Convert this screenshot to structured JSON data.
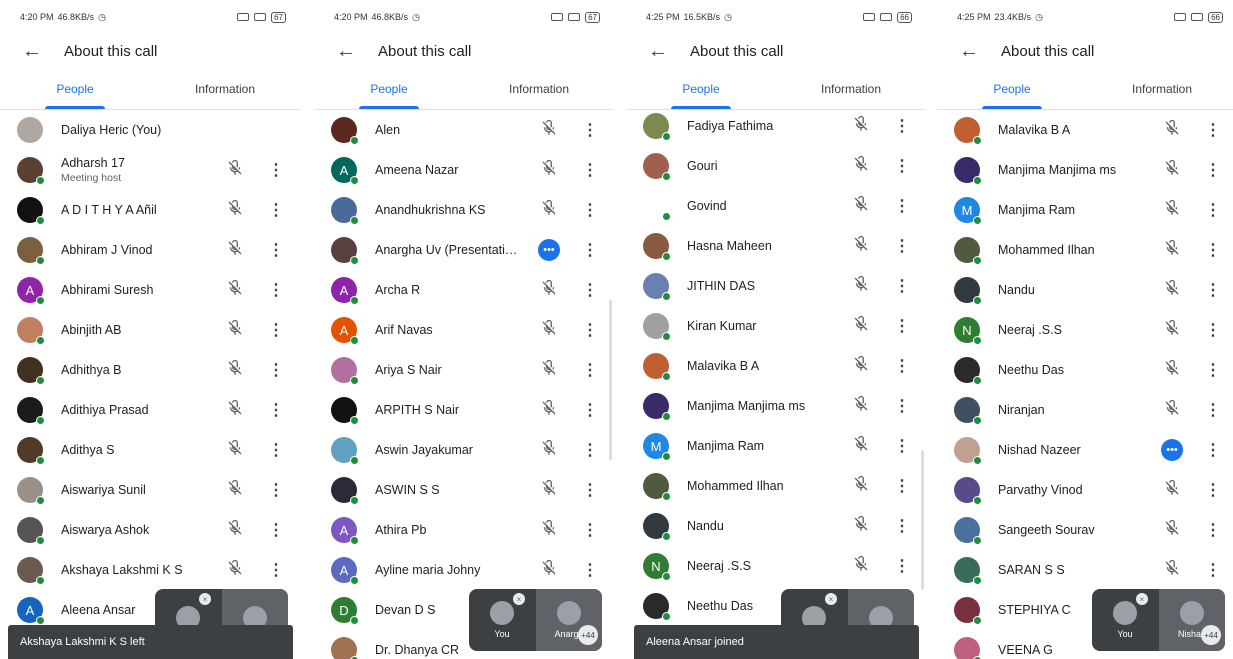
{
  "colors": {
    "accent": "#1a73e8",
    "online": "#1e8e3e",
    "toast": "#3c4043"
  },
  "icons": {
    "back": "arrow-left-icon",
    "mute": "mic-off-icon",
    "more": "more-vert-icon",
    "presenting": "presenting-icon"
  },
  "panels": [
    {
      "status": {
        "time": "4:20 PM",
        "speed": "46.8KB/s",
        "battery": "67"
      },
      "header": {
        "title": "About this call"
      },
      "tabs": {
        "people": "People",
        "information": "Information"
      },
      "people": [
        {
          "name": "Daliya Heric (You)",
          "sub": "",
          "mute": false,
          "more": false,
          "color": "#b0a8a0",
          "letter": ""
        },
        {
          "name": "Adharsh 17",
          "sub": "Meeting host",
          "mute": true,
          "more": true,
          "color": "#5a4030",
          "letter": ""
        },
        {
          "name": "A D I T H Y A Añil",
          "sub": "",
          "mute": true,
          "more": true,
          "color": "#111111",
          "letter": ""
        },
        {
          "name": "Abhiram J Vinod",
          "sub": "",
          "mute": true,
          "more": true,
          "color": "#7a6040",
          "letter": ""
        },
        {
          "name": "Abhirami Suresh",
          "sub": "",
          "mute": true,
          "more": true,
          "color": "#8e24aa",
          "letter": "A"
        },
        {
          "name": "Abinjith AB",
          "sub": "",
          "mute": true,
          "more": true,
          "color": "#c08060",
          "letter": ""
        },
        {
          "name": "Adhithya B",
          "sub": "",
          "mute": true,
          "more": true,
          "color": "#403020",
          "letter": ""
        },
        {
          "name": "Adithiya Prasad",
          "sub": "",
          "mute": true,
          "more": true,
          "color": "#1a1a1a",
          "letter": ""
        },
        {
          "name": "Adithya S",
          "sub": "",
          "mute": true,
          "more": true,
          "color": "#503a28",
          "letter": ""
        },
        {
          "name": "Aiswariya Sunil",
          "sub": "",
          "mute": true,
          "more": true,
          "color": "#9a9088",
          "letter": ""
        },
        {
          "name": "Aiswarya Ashok",
          "sub": "",
          "mute": true,
          "more": true,
          "color": "#555555",
          "letter": ""
        },
        {
          "name": "Akshaya Lakshmi K S",
          "sub": "",
          "mute": true,
          "more": true,
          "color": "#6a5a50",
          "letter": ""
        },
        {
          "name": "Aleena Ansar",
          "sub": "",
          "mute": false,
          "more": false,
          "color": "#1565c0",
          "letter": "A"
        }
      ],
      "toast": "Akshaya Lakshmi K S left",
      "pip": {
        "you_label": "",
        "other_label": "",
        "badge": ""
      }
    },
    {
      "status": {
        "time": "4:20 PM",
        "speed": "46.8KB/s",
        "battery": "67"
      },
      "header": {
        "title": "About this call"
      },
      "tabs": {
        "people": "People",
        "information": "Information"
      },
      "people": [
        {
          "name": "Alen",
          "sub": "",
          "mute": true,
          "more": true,
          "color": "#5a2a20",
          "letter": ""
        },
        {
          "name": "Ameena Nazar",
          "sub": "",
          "mute": true,
          "more": true,
          "color": "#00695c",
          "letter": "A"
        },
        {
          "name": "Anandhukrishna KS",
          "sub": "",
          "mute": true,
          "more": true,
          "color": "#4a6a9a",
          "letter": ""
        },
        {
          "name": "Anargha Uv (Presentati…",
          "sub": "",
          "mute": false,
          "presenting": true,
          "more": true,
          "color": "#5a4040",
          "letter": ""
        },
        {
          "name": "Archa R",
          "sub": "",
          "mute": true,
          "more": true,
          "color": "#8e24aa",
          "letter": "A"
        },
        {
          "name": "Arif Navas",
          "sub": "",
          "mute": true,
          "more": true,
          "color": "#e65100",
          "letter": "A"
        },
        {
          "name": "Ariya S Nair",
          "sub": "",
          "mute": true,
          "more": true,
          "color": "#b070a0",
          "letter": ""
        },
        {
          "name": "ARPITH S Nair",
          "sub": "",
          "mute": true,
          "more": true,
          "color": "#111111",
          "letter": ""
        },
        {
          "name": "Aswin Jayakumar",
          "sub": "",
          "mute": true,
          "more": true,
          "color": "#60a0c0",
          "letter": ""
        },
        {
          "name": "ASWIN S S",
          "sub": "",
          "mute": true,
          "more": true,
          "color": "#2a2a3a",
          "letter": ""
        },
        {
          "name": "Athira Pb",
          "sub": "",
          "mute": true,
          "more": true,
          "color": "#7e57c2",
          "letter": "A"
        },
        {
          "name": "Ayline maria Johny",
          "sub": "",
          "mute": true,
          "more": true,
          "color": "#5c6bc0",
          "letter": "A"
        },
        {
          "name": "Devan D S",
          "sub": "",
          "mute": false,
          "more": false,
          "color": "#2e7d32",
          "letter": "D"
        },
        {
          "name": "Dr. Dhanya CR",
          "sub": "",
          "mute": false,
          "more": false,
          "color": "#a07050",
          "letter": ""
        }
      ],
      "toast": "",
      "pip": {
        "you_label": "You",
        "other_label": "Anargh",
        "badge": "+44"
      }
    },
    {
      "status": {
        "time": "4:25 PM",
        "speed": "16.5KB/s",
        "battery": "66"
      },
      "header": {
        "title": "About this call"
      },
      "tabs": {
        "people": "People",
        "information": "Information"
      },
      "people": [
        {
          "name": "Fadiya Fathima",
          "sub": "",
          "mute": true,
          "more": true,
          "color": "#7a8a50",
          "letter": ""
        },
        {
          "name": "Gouri",
          "sub": "",
          "mute": true,
          "more": true,
          "color": "#a06050",
          "letter": ""
        },
        {
          "name": "Govind",
          "sub": "",
          "mute": true,
          "more": true,
          "color": "#ffffff",
          "letter": ""
        },
        {
          "name": "Hasna Maheen",
          "sub": "",
          "mute": true,
          "more": true,
          "color": "#8a5a40",
          "letter": ""
        },
        {
          "name": "JITHIN DAS",
          "sub": "",
          "mute": true,
          "more": true,
          "color": "#6a80b0",
          "letter": ""
        },
        {
          "name": "Kiran Kumar",
          "sub": "",
          "mute": true,
          "more": true,
          "color": "#a0a0a0",
          "letter": ""
        },
        {
          "name": "Malavika B A",
          "sub": "",
          "mute": true,
          "more": true,
          "color": "#c06030",
          "letter": ""
        },
        {
          "name": "Manjima Manjima ms",
          "sub": "",
          "mute": true,
          "more": true,
          "color": "#3a2a6a",
          "letter": ""
        },
        {
          "name": "Manjima Ram",
          "sub": "",
          "mute": true,
          "more": true,
          "color": "#1e88e5",
          "letter": "M"
        },
        {
          "name": "Mohammed Ilhan",
          "sub": "",
          "mute": true,
          "more": true,
          "color": "#505a40",
          "letter": ""
        },
        {
          "name": "Nandu",
          "sub": "",
          "mute": true,
          "more": true,
          "color": "#303a40",
          "letter": ""
        },
        {
          "name": "Neeraj .S.S",
          "sub": "",
          "mute": true,
          "more": true,
          "color": "#2e7d32",
          "letter": "N"
        },
        {
          "name": "Neethu Das",
          "sub": "",
          "mute": false,
          "more": false,
          "color": "#2a2a2a",
          "letter": ""
        }
      ],
      "toast": "Aleena Ansar joined",
      "pip": {
        "you_label": "",
        "other_label": "",
        "badge": ""
      }
    },
    {
      "status": {
        "time": "4:25 PM",
        "speed": "23.4KB/s",
        "battery": "66"
      },
      "header": {
        "title": "About this call"
      },
      "tabs": {
        "people": "People",
        "information": "Information"
      },
      "people": [
        {
          "name": "Malavika B A",
          "sub": "",
          "mute": true,
          "more": true,
          "color": "#c06030",
          "letter": ""
        },
        {
          "name": "Manjima Manjima ms",
          "sub": "",
          "mute": true,
          "more": true,
          "color": "#3a2a6a",
          "letter": ""
        },
        {
          "name": "Manjima Ram",
          "sub": "",
          "mute": true,
          "more": true,
          "color": "#1e88e5",
          "letter": "M"
        },
        {
          "name": "Mohammed Ilhan",
          "sub": "",
          "mute": true,
          "more": true,
          "color": "#505a40",
          "letter": ""
        },
        {
          "name": "Nandu",
          "sub": "",
          "mute": true,
          "more": true,
          "color": "#303a40",
          "letter": ""
        },
        {
          "name": "Neeraj .S.S",
          "sub": "",
          "mute": true,
          "more": true,
          "color": "#2e7d32",
          "letter": "N"
        },
        {
          "name": "Neethu Das",
          "sub": "",
          "mute": true,
          "more": true,
          "color": "#2a2a2a",
          "letter": ""
        },
        {
          "name": "Niranjan",
          "sub": "",
          "mute": true,
          "more": true,
          "color": "#405060",
          "letter": ""
        },
        {
          "name": "Nishad Nazeer",
          "sub": "",
          "mute": false,
          "presenting": true,
          "more": true,
          "color": "#c0a090",
          "letter": ""
        },
        {
          "name": "Parvathy Vinod",
          "sub": "",
          "mute": true,
          "more": true,
          "color": "#5a4a8a",
          "letter": ""
        },
        {
          "name": "Sangeeth Sourav",
          "sub": "",
          "mute": true,
          "more": true,
          "color": "#4a70a0",
          "letter": ""
        },
        {
          "name": "SARAN S S",
          "sub": "",
          "mute": true,
          "more": true,
          "color": "#3a6a5a",
          "letter": ""
        },
        {
          "name": "STEPHIYA C",
          "sub": "",
          "mute": false,
          "more": false,
          "color": "#7a3040",
          "letter": ""
        },
        {
          "name": "VEENA G",
          "sub": "",
          "mute": false,
          "more": false,
          "color": "#c06080",
          "letter": ""
        }
      ],
      "toast": "",
      "pip": {
        "you_label": "You",
        "other_label": "Nishad",
        "badge": "+44"
      }
    }
  ]
}
